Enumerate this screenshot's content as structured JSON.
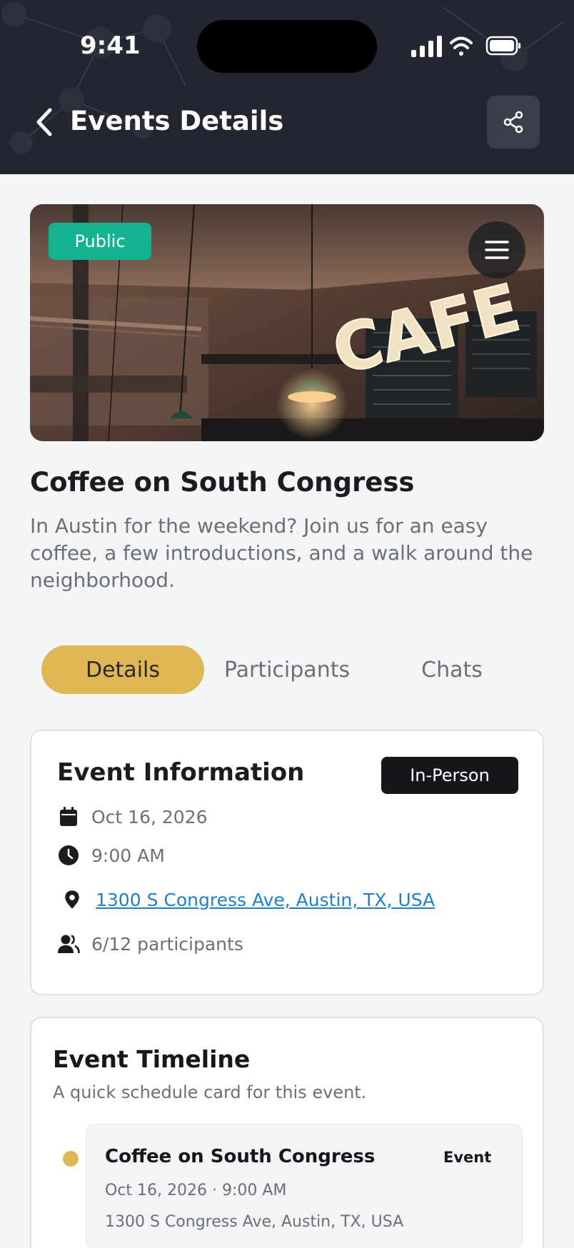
{
  "status_bar": {
    "time": "9:41"
  },
  "nav": {
    "title": "Events Details",
    "back_icon": "chevron-left-icon",
    "share_icon": "share-icon"
  },
  "hero": {
    "badge": "Public",
    "menu_icon": "hamburger-menu-icon",
    "image": "cafe-interior-photo"
  },
  "event": {
    "title": "Coffee on South Congress",
    "description": "In Austin for the weekend? Join us for an easy coffee, a few introductions, and a walk around the neighborhood."
  },
  "tabs": [
    {
      "label": "Details",
      "active": true
    },
    {
      "label": "Participants",
      "active": false
    },
    {
      "label": "Chats",
      "active": false
    }
  ],
  "info": {
    "heading": "Event Information",
    "type_badge": "In-Person",
    "date": "Oct 16, 2026",
    "time": "9:00 AM",
    "address": "1300 S Congress Ave, Austin, TX, USA",
    "participants": "6/12 participants"
  },
  "timeline": {
    "heading": "Event Timeline",
    "subtitle": "A quick schedule card for this event.",
    "items": [
      {
        "title": "Coffee on South Congress",
        "type": "Event",
        "datetime": "Oct 16, 2026 · 9:00 AM",
        "address": "1300 S Congress Ave, Austin, TX, USA"
      }
    ]
  },
  "colors": {
    "header_bg": "#232630",
    "accent_gold": "#e0b755",
    "public_green": "#14b38f",
    "link_blue": "#1e80c8",
    "page_bg": "#f4f5f7"
  }
}
